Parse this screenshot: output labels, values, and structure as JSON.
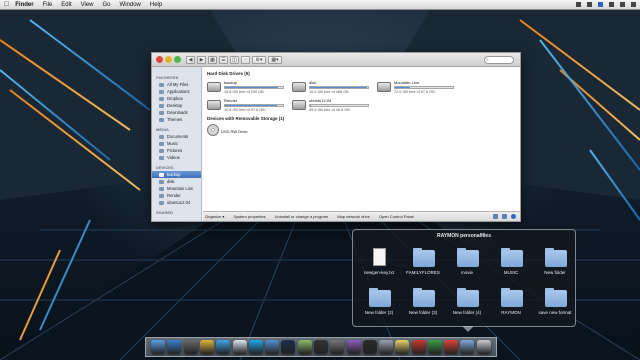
{
  "menubar": {
    "app_name": "Finder",
    "items": [
      "File",
      "Edit",
      "View",
      "Go",
      "Window",
      "Help"
    ]
  },
  "finder": {
    "search_placeholder": "",
    "sidebar": {
      "groups": [
        {
          "title": "FAVORITES",
          "items": [
            "All My Files",
            "Applications",
            "Dropbox",
            "Desktop",
            "Downloads",
            "Themes"
          ]
        },
        {
          "title": "MEDIA",
          "items": [
            "Documents",
            "Music",
            "Pictures",
            "Videos"
          ]
        },
        {
          "title": "DEVICES",
          "items": [
            "backup",
            "disk",
            "Mountain Lion",
            "Render",
            "ubuntu12.04"
          ]
        },
        {
          "title": "SHARED",
          "items": []
        }
      ]
    },
    "hard_disk_section": "Hard Disk Drives (5)",
    "drives": [
      {
        "name": "backup",
        "free_text": "15.8 GB free of 200 GB",
        "used_fraction": 0.92
      },
      {
        "name": "disk",
        "free_text": "10.0 GB free of 488 GB",
        "used_fraction": 0.98
      },
      {
        "name": "Mountain Lion",
        "free_text": "72.6 GB free of 97.6 GB",
        "used_fraction": 0.26
      },
      {
        "name": "Render",
        "free_text": "10.8 GB free of 97.6 GB",
        "used_fraction": 0.89
      },
      {
        "name": "ubuntu12.04",
        "free_text": "49.9 GB free of 48.8 GB",
        "used_fraction": 0.02
      }
    ],
    "removable_section": "Devices with Removable Storage (1)",
    "dvd_label": "DVD RW Drive",
    "statusbar": {
      "items": [
        "Organize ▾",
        "System properties",
        "Uninstall or change a program",
        "Map network drive",
        "Open Control Panel"
      ]
    }
  },
  "stack": {
    "title": "RAYMON personalfiles",
    "items": [
      {
        "label": "newgen-key.txt",
        "kind": "document"
      },
      {
        "label": "FAMILYFLORES",
        "kind": "folder"
      },
      {
        "label": "movie",
        "kind": "folder"
      },
      {
        "label": "MUSIC",
        "kind": "folder"
      },
      {
        "label": "New folder",
        "kind": "folder"
      },
      {
        "label": "New folder (2)",
        "kind": "folder"
      },
      {
        "label": "New folder (3)",
        "kind": "folder"
      },
      {
        "label": "New folder (4)",
        "kind": "folder"
      },
      {
        "label": "RAYMON",
        "kind": "folder"
      },
      {
        "label": "save new format",
        "kind": "folder"
      }
    ]
  },
  "dock": {
    "icons": [
      {
        "name": "finder-icon",
        "color": "#5aa0e6"
      },
      {
        "name": "app-store-icon",
        "color": "#3a7fd0"
      },
      {
        "name": "photo-icon",
        "color": "#6a6a6a"
      },
      {
        "name": "chrome-icon",
        "color": "#e0b43a"
      },
      {
        "name": "safari-icon",
        "color": "#3fa4e8"
      },
      {
        "name": "mail-icon",
        "color": "#dfe6ef"
      },
      {
        "name": "skype-icon",
        "color": "#1fa8e8"
      },
      {
        "name": "itunes-icon",
        "color": "#4f8fd8"
      },
      {
        "name": "photoshop-icon",
        "color": "#1d2f4e"
      },
      {
        "name": "iphoto-icon",
        "color": "#8db86a"
      },
      {
        "name": "css-icon",
        "color": "#333333"
      },
      {
        "name": "utility-icon",
        "color": "#777777"
      },
      {
        "name": "itunes-purple-icon",
        "color": "#8b5bbd"
      },
      {
        "name": "activity-icon",
        "color": "#2b2b2b"
      },
      {
        "name": "settings-icon",
        "color": "#9aa4ae"
      },
      {
        "name": "notes-icon",
        "color": "#e8d36a"
      },
      {
        "name": "crossover-icon",
        "color": "#c63a2e"
      },
      {
        "name": "star-icon",
        "color": "#39a047"
      },
      {
        "name": "number-four-icon",
        "color": "#d8443a"
      },
      {
        "name": "downloads-stack-icon",
        "color": "#7fa8d8"
      },
      {
        "name": "trash-icon",
        "color": "#c7cdd3"
      }
    ]
  }
}
